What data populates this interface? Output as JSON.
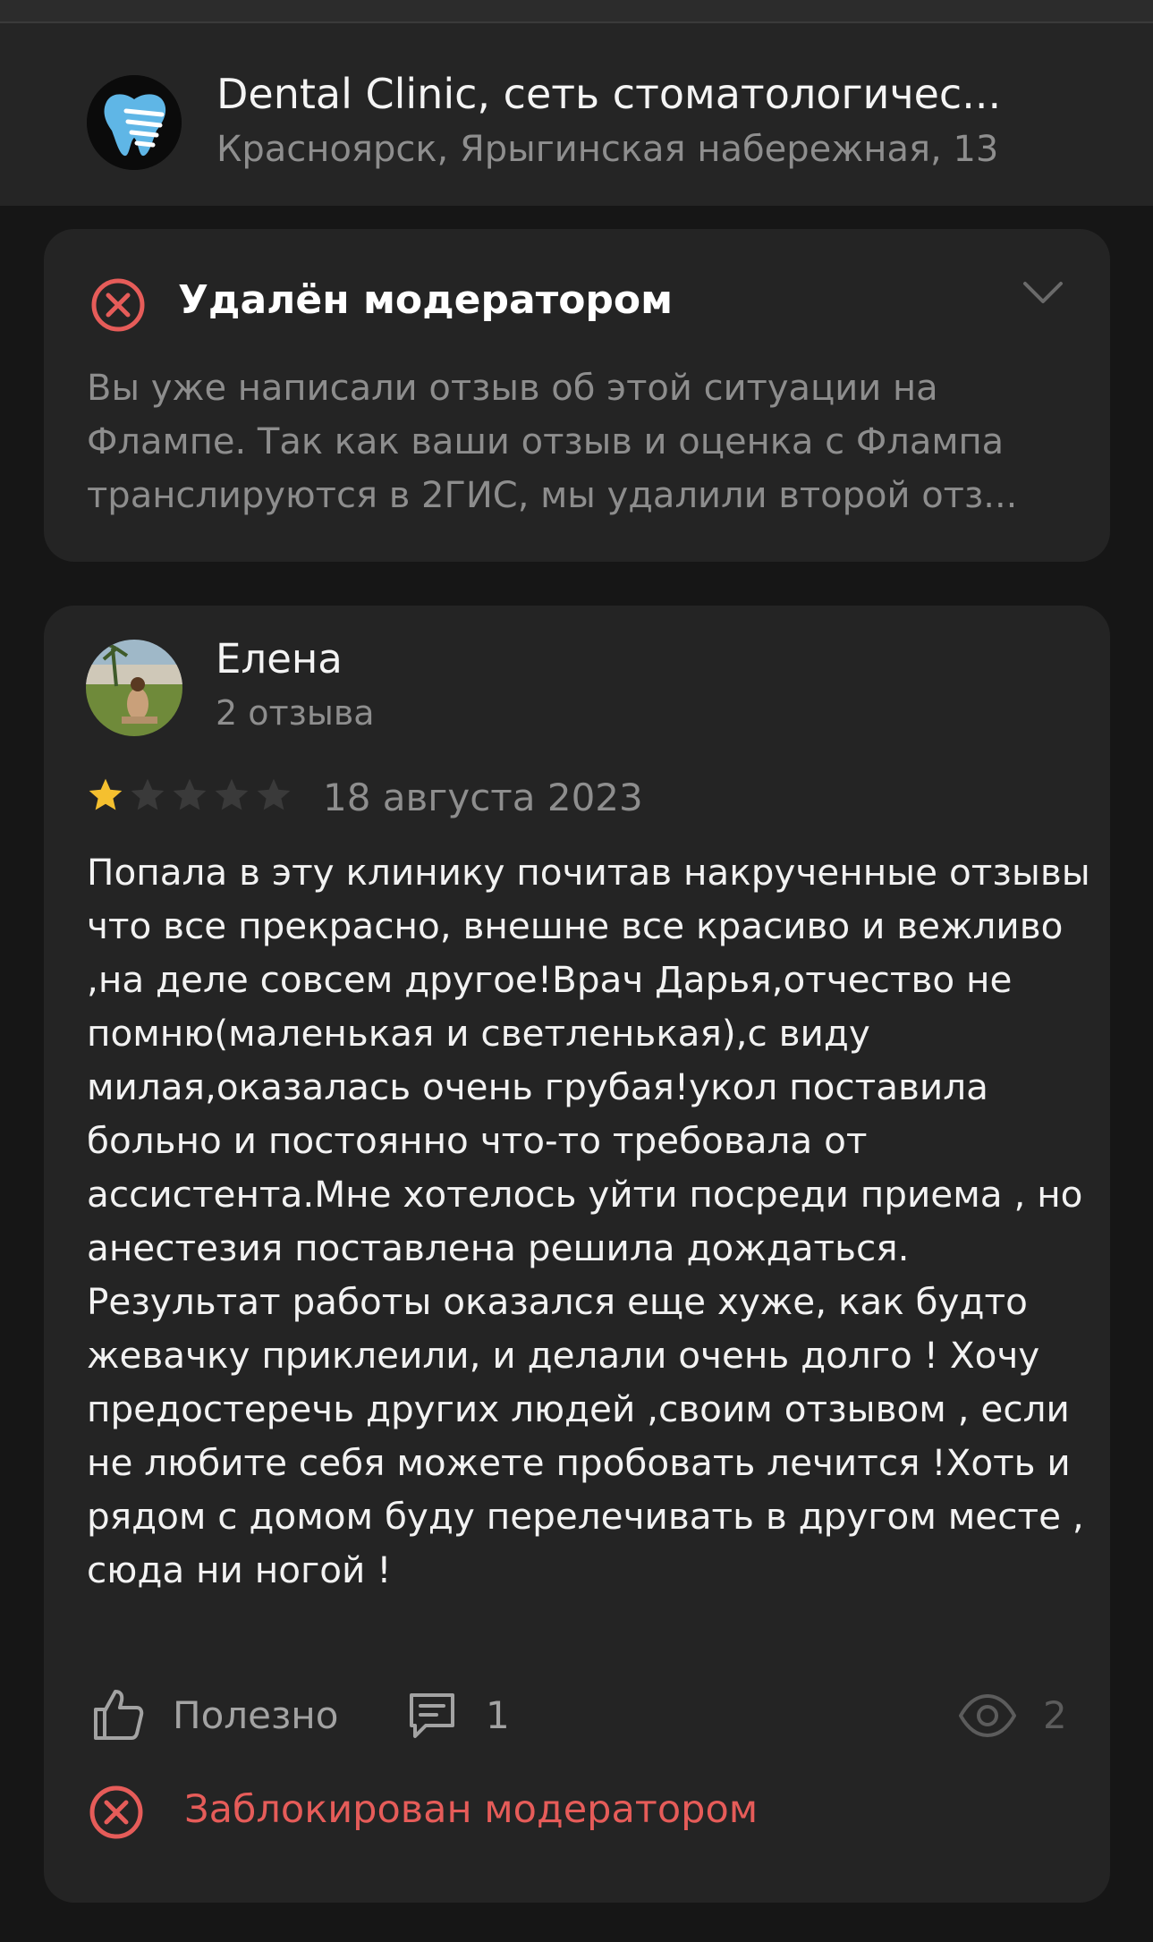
{
  "header": {
    "title": "Dental Clinic, сеть стоматологичес...",
    "address": "Красноярск, Ярыгинская набережная, 13",
    "logo_icon": "tooth-logo-icon"
  },
  "moderation": {
    "title": "Удалён модератором",
    "text": "Вы уже написали отзыв об этой ситуации на Флампе. Так как ваши отзыв и оценка с Флампа транслируются в 2ГИС, мы удалили второй отз..."
  },
  "review": {
    "author": "Елена",
    "review_count": "2 отзыва",
    "rating": 1,
    "max_rating": 5,
    "date": "18 августа 2023",
    "text": "Попала в эту клинику почитав накрученные отзывы что все прекрасно, внешне все красиво и вежливо ,на деле совсем другое!Врач Дарья,отчество не помню(маленькая и светленькая),с виду милая,оказалась очень грубая!укол поставила больно и постоянно что-то требовала от ассистента.Мне хотелось уйти посреди приема , но анестезия поставлена решила дождаться. Результат работы оказался еще хуже, как будто жевачку приклеили, и делали очень долго ! Хочу предостеречь других людей ,своим отзывом , если не любите себя можете пробовать лечится !Хоть и рядом с домом буду перелечивать в другом месте , сюда ни ногой !",
    "useful_label": "Полезно",
    "comments_count": "1",
    "views_count": "2",
    "blocked_label": "Заблокирован модератором"
  },
  "colors": {
    "background": "#161616",
    "card": "#242424",
    "star_active": "#f5c02f",
    "star_inactive": "#3a3a3a",
    "danger": "#e65c59"
  }
}
